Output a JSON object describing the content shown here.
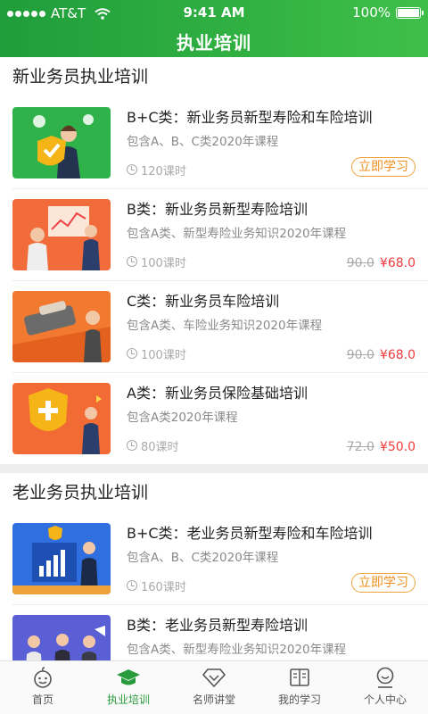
{
  "status_bar": {
    "carrier": "AT&T",
    "time": "9:41 AM",
    "battery": "100%"
  },
  "header": {
    "title": "执业培训"
  },
  "sections": [
    {
      "title": "新业务员执业培训",
      "courses": [
        {
          "title": "B+C类：新业务员新型寿险和车险培训",
          "subtitle": "包含A、B、C类2020年课程",
          "hours": "120课时",
          "action": "立即学习"
        },
        {
          "title": "B类：新业务员新型寿险培训",
          "subtitle": "包含A类、新型寿险业务知识2020年课程",
          "hours": "100课时",
          "original_price": "90.0",
          "price": "¥68.0"
        },
        {
          "title": "C类：新业务员车险培训",
          "subtitle": "包含A类、车险业务知识2020年课程",
          "hours": "100课时",
          "original_price": "90.0",
          "price": "¥68.0"
        },
        {
          "title": "A类：新业务员保险基础培训",
          "subtitle": "包含A类2020年课程",
          "hours": "80课时",
          "original_price": "72.0",
          "price": "¥50.0"
        }
      ]
    },
    {
      "title": "老业务员执业培训",
      "courses": [
        {
          "title": "B+C类：老业务员新型寿险和车险培训",
          "subtitle": "包含A、B、C类2020年课程",
          "hours": "160课时",
          "action": "立即学习"
        },
        {
          "title": "B类：老业务员新型寿险培训",
          "subtitle": "包含A类、新型寿险业务知识2020年课程"
        }
      ]
    }
  ],
  "tabbar": {
    "items": [
      {
        "label": "首页",
        "icon": "home-icon"
      },
      {
        "label": "执业培训",
        "icon": "graduation-cap-icon",
        "active": true
      },
      {
        "label": "名师讲堂",
        "icon": "diamond-icon"
      },
      {
        "label": "我的学习",
        "icon": "book-icon"
      },
      {
        "label": "个人中心",
        "icon": "user-icon"
      }
    ]
  },
  "colors": {
    "brand_green": "#2a9b3c",
    "action_orange": "#ef8f1d",
    "price_red": "#f23b3b"
  }
}
